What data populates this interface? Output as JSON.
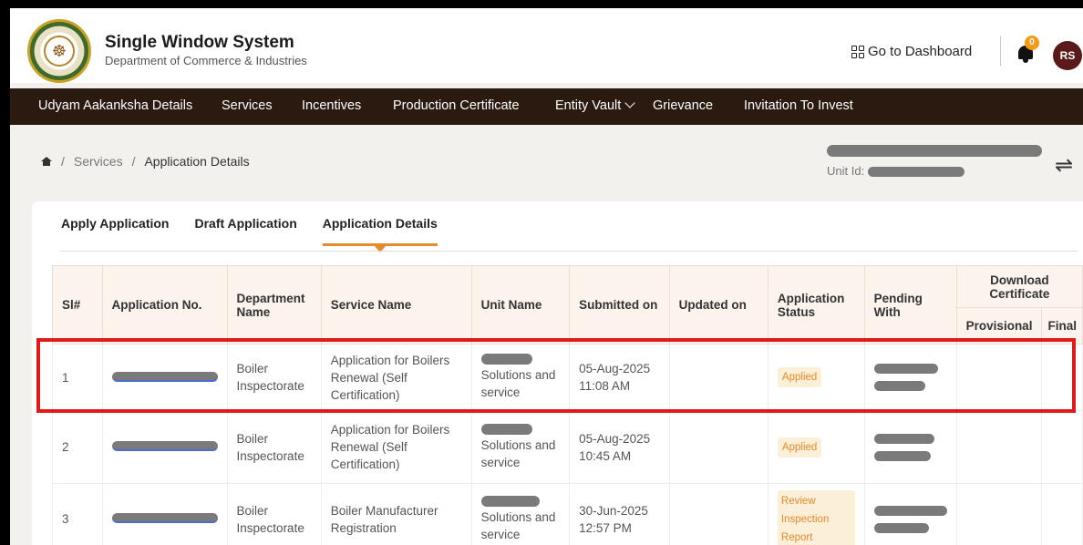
{
  "header": {
    "title": "Single Window System",
    "subtitle": "Department of Commerce & Industries",
    "dashboard_link": "Go to Dashboard",
    "notification_count": "0",
    "avatar_initials": "RS"
  },
  "nav": {
    "items": [
      {
        "label": "Udyam Aakanksha Details"
      },
      {
        "label": "Services"
      },
      {
        "label": "Incentives"
      },
      {
        "label": "Production Certificate"
      },
      {
        "label": "Entity Vault"
      },
      {
        "label": "Grievance"
      },
      {
        "label": "Invitation To Invest"
      }
    ]
  },
  "breadcrumb": {
    "items": [
      "Services",
      "Application Details"
    ]
  },
  "unit": {
    "id_label": "Unit Id:"
  },
  "tabs": [
    {
      "label": "Apply Application",
      "active": false
    },
    {
      "label": "Draft Application",
      "active": false
    },
    {
      "label": "Application Details",
      "active": true
    }
  ],
  "table": {
    "headers": {
      "sl": "Sl#",
      "app_no": "Application No.",
      "department": "Department Name",
      "service": "Service Name",
      "unit": "Unit Name",
      "submitted": "Submitted on",
      "updated": "Updated on",
      "status": "Application Status",
      "pending": "Pending With",
      "download": "Download Certificate",
      "provisional": "Provisional",
      "final": "Final"
    },
    "rows": [
      {
        "sl": "1",
        "department": "Boiler Inspectorate",
        "service": "Application for Boilers Renewal (Self Certification)",
        "unit": "Solutions and service",
        "submitted_date": "05-Aug-2025",
        "submitted_time": "11:08 AM",
        "updated": "",
        "status": "Applied"
      },
      {
        "sl": "2",
        "department": "Boiler Inspectorate",
        "service": "Application for Boilers Renewal (Self Certification)",
        "unit": "Solutions and service",
        "submitted_date": "05-Aug-2025",
        "submitted_time": "10:45 AM",
        "updated": "",
        "status": "Applied"
      },
      {
        "sl": "3",
        "department": "Boiler Inspectorate",
        "service": "Boiler Manufacturer Registration",
        "unit": "Solutions and service",
        "submitted_date": "30-Jun-2025",
        "submitted_time": "12:57 PM",
        "updated": "",
        "status": "Review Inspection Report"
      }
    ]
  },
  "colors": {
    "nav_bg": "#2a1a10",
    "accent": "#e8892b",
    "highlight": "#e01a1a",
    "header_bg": "#fcf3ec"
  }
}
